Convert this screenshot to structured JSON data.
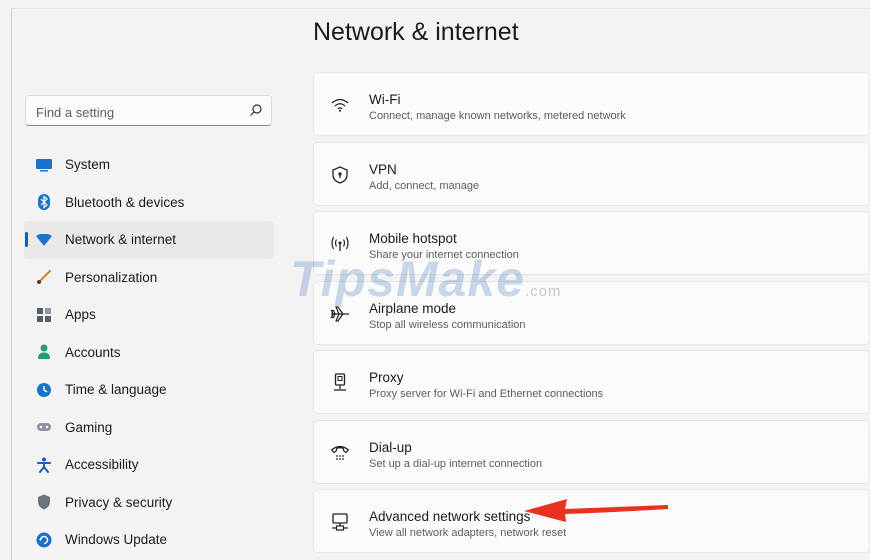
{
  "page_title": "Network & internet",
  "search": {
    "placeholder": "Find a setting",
    "value": ""
  },
  "sidebar": {
    "items": [
      {
        "label": "System",
        "icon": "monitor-icon",
        "color": "#1a73c9"
      },
      {
        "label": "Bluetooth & devices",
        "icon": "bluetooth-icon",
        "color": "#1a73c9"
      },
      {
        "label": "Network & internet",
        "icon": "wifi-icon",
        "color": "#1a73c9",
        "active": true
      },
      {
        "label": "Personalization",
        "icon": "brush-icon",
        "color": "#d9822b"
      },
      {
        "label": "Apps",
        "icon": "apps-icon",
        "color": "#555f6b"
      },
      {
        "label": "Accounts",
        "icon": "person-icon",
        "color": "#22a06b"
      },
      {
        "label": "Time & language",
        "icon": "globe-clock-icon",
        "color": "#1a73c9"
      },
      {
        "label": "Gaming",
        "icon": "gamepad-icon",
        "color": "#7d8590"
      },
      {
        "label": "Accessibility",
        "icon": "accessibility-icon",
        "color": "#1a5fb4"
      },
      {
        "label": "Privacy & security",
        "icon": "shield-icon",
        "color": "#6b7480"
      },
      {
        "label": "Windows Update",
        "icon": "update-icon",
        "color": "#1a73c9"
      }
    ]
  },
  "cards": [
    {
      "title": "Wi-Fi",
      "desc": "Connect, manage known networks, metered network",
      "icon": "wifi-icon"
    },
    {
      "title": "VPN",
      "desc": "Add, connect, manage",
      "icon": "vpn-shield-icon"
    },
    {
      "title": "Mobile hotspot",
      "desc": "Share your internet connection",
      "icon": "hotspot-icon"
    },
    {
      "title": "Airplane mode",
      "desc": "Stop all wireless communication",
      "icon": "airplane-icon"
    },
    {
      "title": "Proxy",
      "desc": "Proxy server for Wi-Fi and Ethernet connections",
      "icon": "proxy-icon"
    },
    {
      "title": "Dial-up",
      "desc": "Set up a dial-up internet connection",
      "icon": "dialup-icon"
    },
    {
      "title": "Advanced network settings",
      "desc": "View all network adapters, network reset",
      "icon": "network-adapter-icon"
    }
  ],
  "watermark": {
    "text": "TipsMake",
    "suffix": ".com"
  },
  "colors": {
    "accent": "#0067c0",
    "arrow": "#e8321e"
  }
}
